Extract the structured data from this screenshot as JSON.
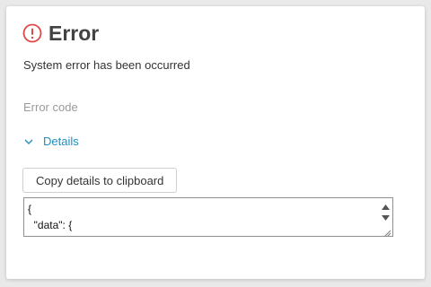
{
  "dialog": {
    "title": "Error",
    "icon": "error-circle-icon",
    "message": "System error has been occurred",
    "error_code_label": "Error code",
    "details_label": "Details",
    "details_expanded": true,
    "copy_button_label": "Copy details to clipboard",
    "details_content": "{\n  \"data\": {"
  },
  "colors": {
    "error_red": "#e04848",
    "link_blue": "#1f8fc2",
    "title_gray": "#424242"
  }
}
